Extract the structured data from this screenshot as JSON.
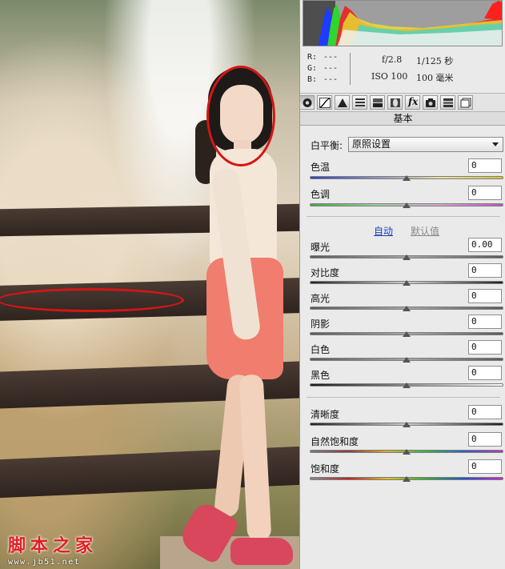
{
  "watermark": {
    "text": "脚本之家",
    "url": "www.jb51.net"
  },
  "readout": {
    "r_label": "R:",
    "r_value": "---",
    "g_label": "G:",
    "g_value": "---",
    "b_label": "B:",
    "b_value": "---",
    "aperture": "f/2.8",
    "shutter": "1/125 秒",
    "iso": "ISO 100",
    "focal": "100 毫米"
  },
  "toolbar_icons": [
    "aperture-icon",
    "tone-curve-icon",
    "detail-icon",
    "hsl-icon",
    "split-toning-icon",
    "lens-icon",
    "fx-icon",
    "camera-icon",
    "presets-icon",
    "snapshots-icon"
  ],
  "toolbar_fx_label": "fx",
  "section": {
    "title": "基本"
  },
  "white_balance": {
    "label": "白平衡:",
    "value": "原照设置"
  },
  "controls_wb": [
    {
      "label": "色温",
      "value": "0",
      "position": 0.5
    },
    {
      "label": "色调",
      "value": "0",
      "position": 0.5
    }
  ],
  "links": {
    "auto": "自动",
    "default": "默认值"
  },
  "controls_tone": [
    {
      "label": "曝光",
      "value": "0.00",
      "position": 0.5
    },
    {
      "label": "对比度",
      "value": "0",
      "position": 0.5
    },
    {
      "label": "高光",
      "value": "0",
      "position": 0.5
    },
    {
      "label": "阴影",
      "value": "0",
      "position": 0.5
    },
    {
      "label": "白色",
      "value": "0",
      "position": 0.5
    },
    {
      "label": "黑色",
      "value": "0",
      "position": 0.5
    }
  ],
  "controls_presence": [
    {
      "label": "清晰度",
      "value": "0",
      "position": 0.5
    },
    {
      "label": "自然饱和度",
      "value": "0",
      "position": 0.5
    },
    {
      "label": "饱和度",
      "value": "0",
      "position": 0.5
    }
  ],
  "colors": {
    "annotation": "#d41616",
    "link": "#1a3fb8",
    "watermark": "#e02020"
  }
}
